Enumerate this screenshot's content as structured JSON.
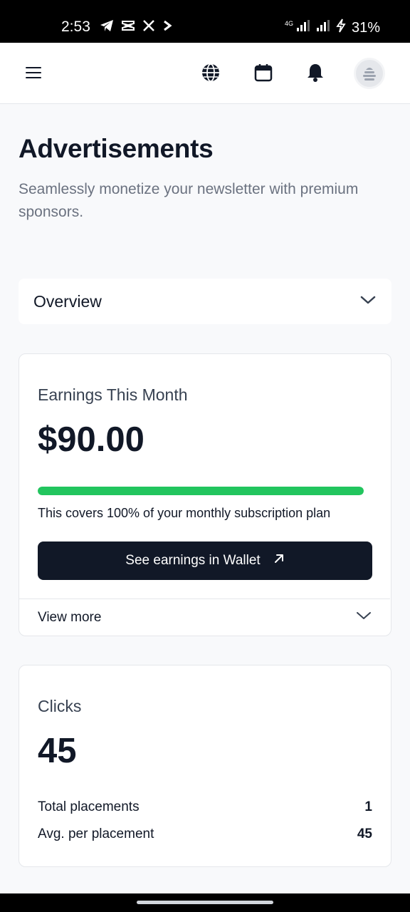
{
  "status_bar": {
    "time": "2:53",
    "network": "4G",
    "battery": "31%"
  },
  "page": {
    "title": "Advertisements",
    "subtitle": "Seamlessly monetize your newsletter with premium sponsors."
  },
  "overview_select": {
    "selected": "Overview"
  },
  "earnings": {
    "label": "Earnings This Month",
    "amount": "$90.00",
    "progress_percent": 100,
    "caption": "This covers 100% of your monthly subscription plan",
    "wallet_button": "See earnings in Wallet",
    "view_more": "View more"
  },
  "clicks": {
    "label": "Clicks",
    "value": "45",
    "stats": [
      {
        "label": "Total placements",
        "value": "1"
      },
      {
        "label": "Avg. per placement",
        "value": "45"
      }
    ]
  },
  "colors": {
    "accent_green": "#22c55e",
    "button_dark": "#111827"
  }
}
